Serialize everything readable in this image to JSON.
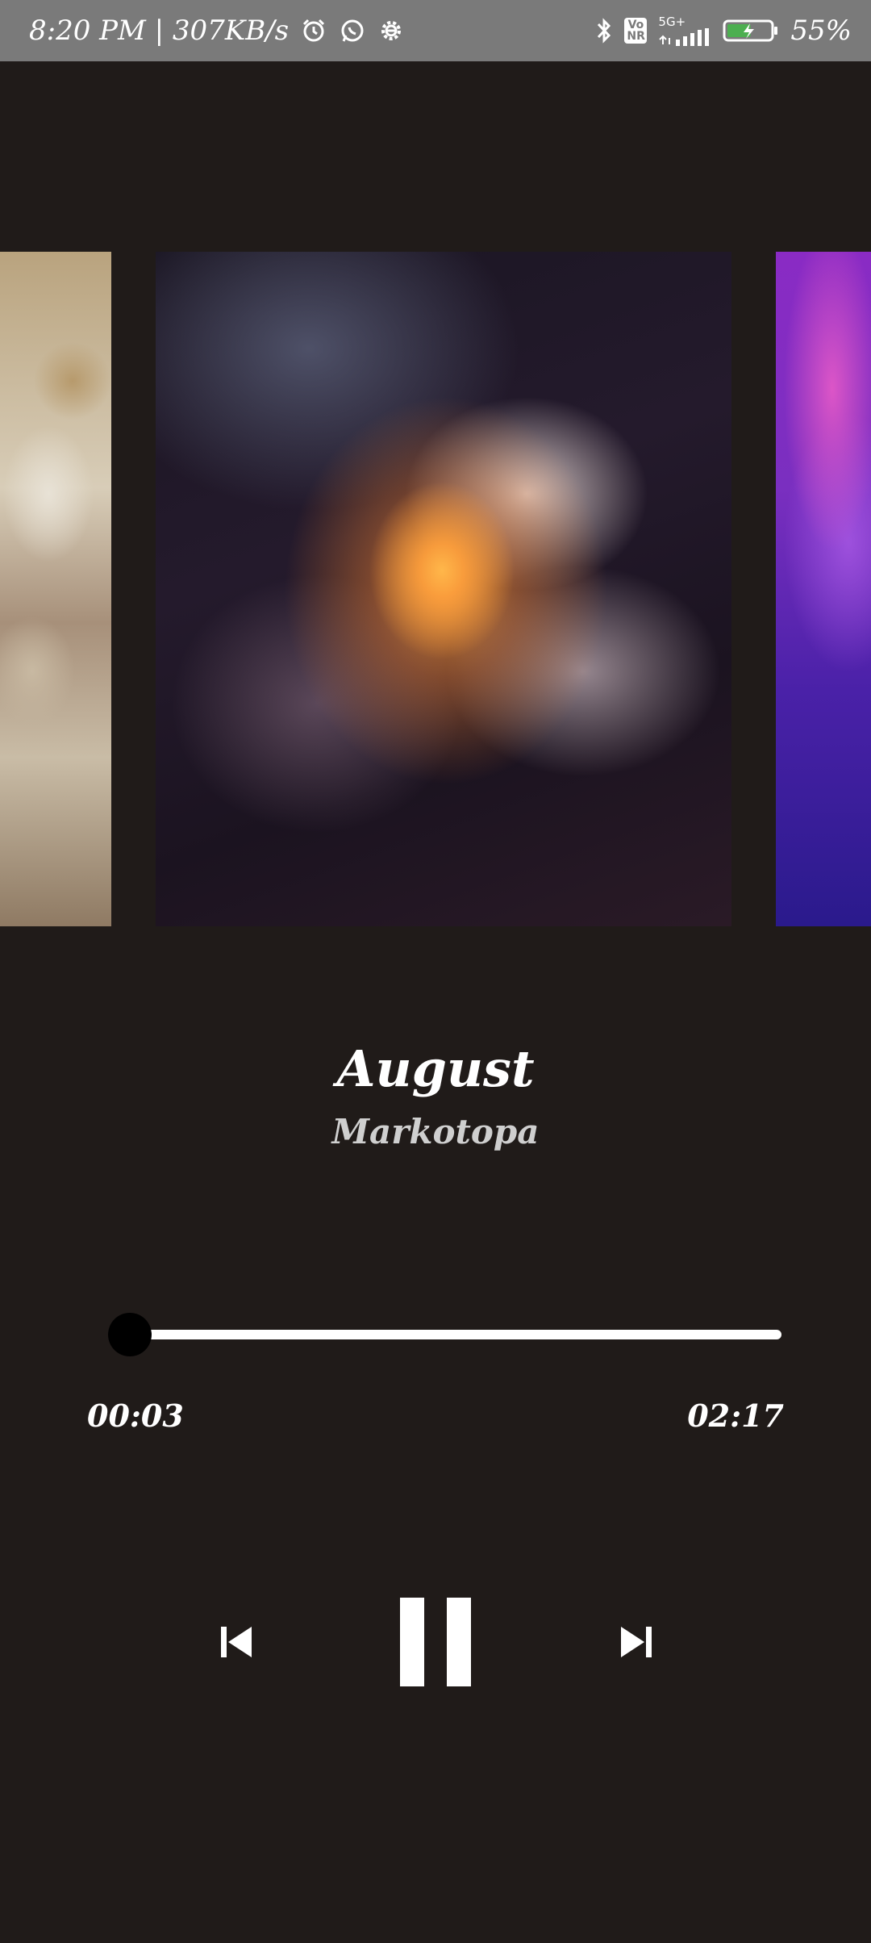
{
  "status_bar": {
    "time_speed": "8:20 PM | 307KB/s",
    "network_badge_top": "Vo",
    "network_badge_bottom": "NR",
    "network_type": "5G+",
    "battery_percent": "55%",
    "battery_level": 0.55,
    "icons": [
      "alarm-icon",
      "whatsapp-icon",
      "settings-gear-icon",
      "bluetooth-icon",
      "signal-icon",
      "battery-charging-icon"
    ]
  },
  "carousel": {
    "items": [
      {
        "name": "previous-album-art",
        "colors": [
          "#b9a37e",
          "#d8cdb8"
        ]
      },
      {
        "name": "current-album-art",
        "colors": [
          "#241a2c",
          "#ffb74a"
        ]
      },
      {
        "name": "next-album-art",
        "colors": [
          "#8a2bc4",
          "#2a1a8c"
        ]
      }
    ]
  },
  "track": {
    "title": "August",
    "artist": "Markotopa"
  },
  "progress": {
    "elapsed": "00:03",
    "total": "02:17",
    "fraction": 0.022
  },
  "controls": {
    "icons": [
      "skip-previous-icon",
      "pause-icon",
      "skip-next-icon"
    ]
  },
  "colors": {
    "background": "#201b19",
    "status_bar": "#7a7a7a",
    "accent": "#ffffff"
  }
}
